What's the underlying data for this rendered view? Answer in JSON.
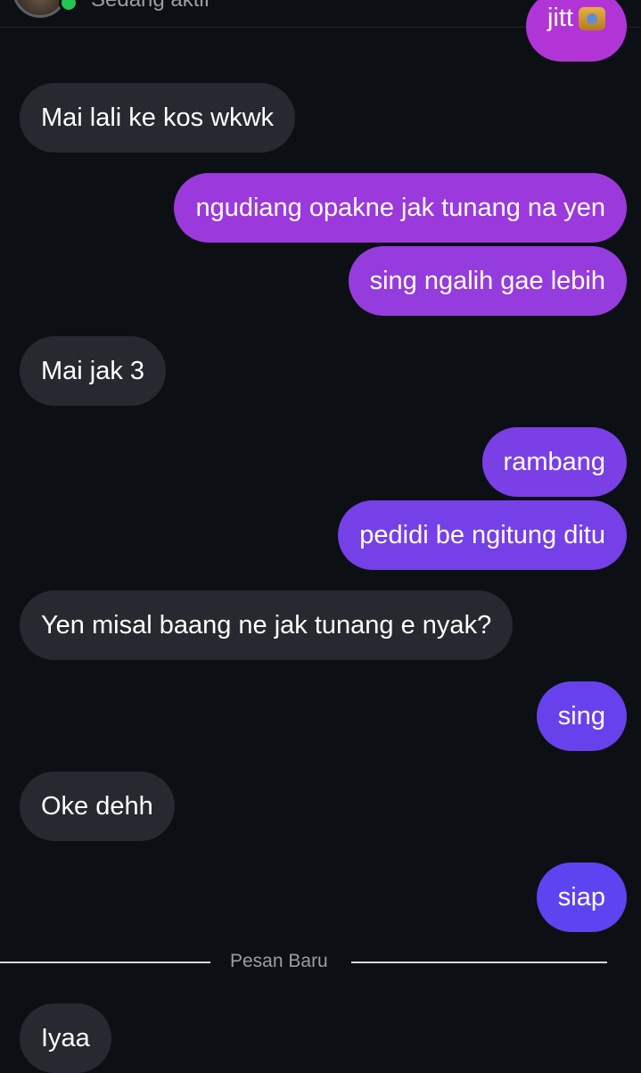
{
  "header": {
    "status": "Sedang aktif"
  },
  "messages": [
    {
      "side": "right",
      "text": "jitt"
    },
    {
      "side": "left",
      "text": "Mai lali ke kos wkwk"
    },
    {
      "side": "right",
      "text": "ngudiang opakne jak tunang na yen"
    },
    {
      "side": "right",
      "text": "sing ngalih gae lebih"
    },
    {
      "side": "left",
      "text": "Mai jak 3"
    },
    {
      "side": "right",
      "text": "rambang"
    },
    {
      "side": "right",
      "text": "pedidi be ngitung ditu"
    },
    {
      "side": "left",
      "text": "Yen misal baang ne jak tunang e nyak?"
    },
    {
      "side": "right",
      "text": "sing"
    },
    {
      "side": "left",
      "text": "Oke dehh"
    },
    {
      "side": "right",
      "text": "siap"
    },
    {
      "side": "left",
      "text": "Iyaa"
    }
  ],
  "divider": {
    "label": "Pesan Baru"
  },
  "colors": {
    "background": "#0c0f14",
    "incoming_bubble": "#26292f",
    "outgoing_gradient_top": "#b135d6",
    "outgoing_gradient_bottom": "#5c44f0"
  }
}
